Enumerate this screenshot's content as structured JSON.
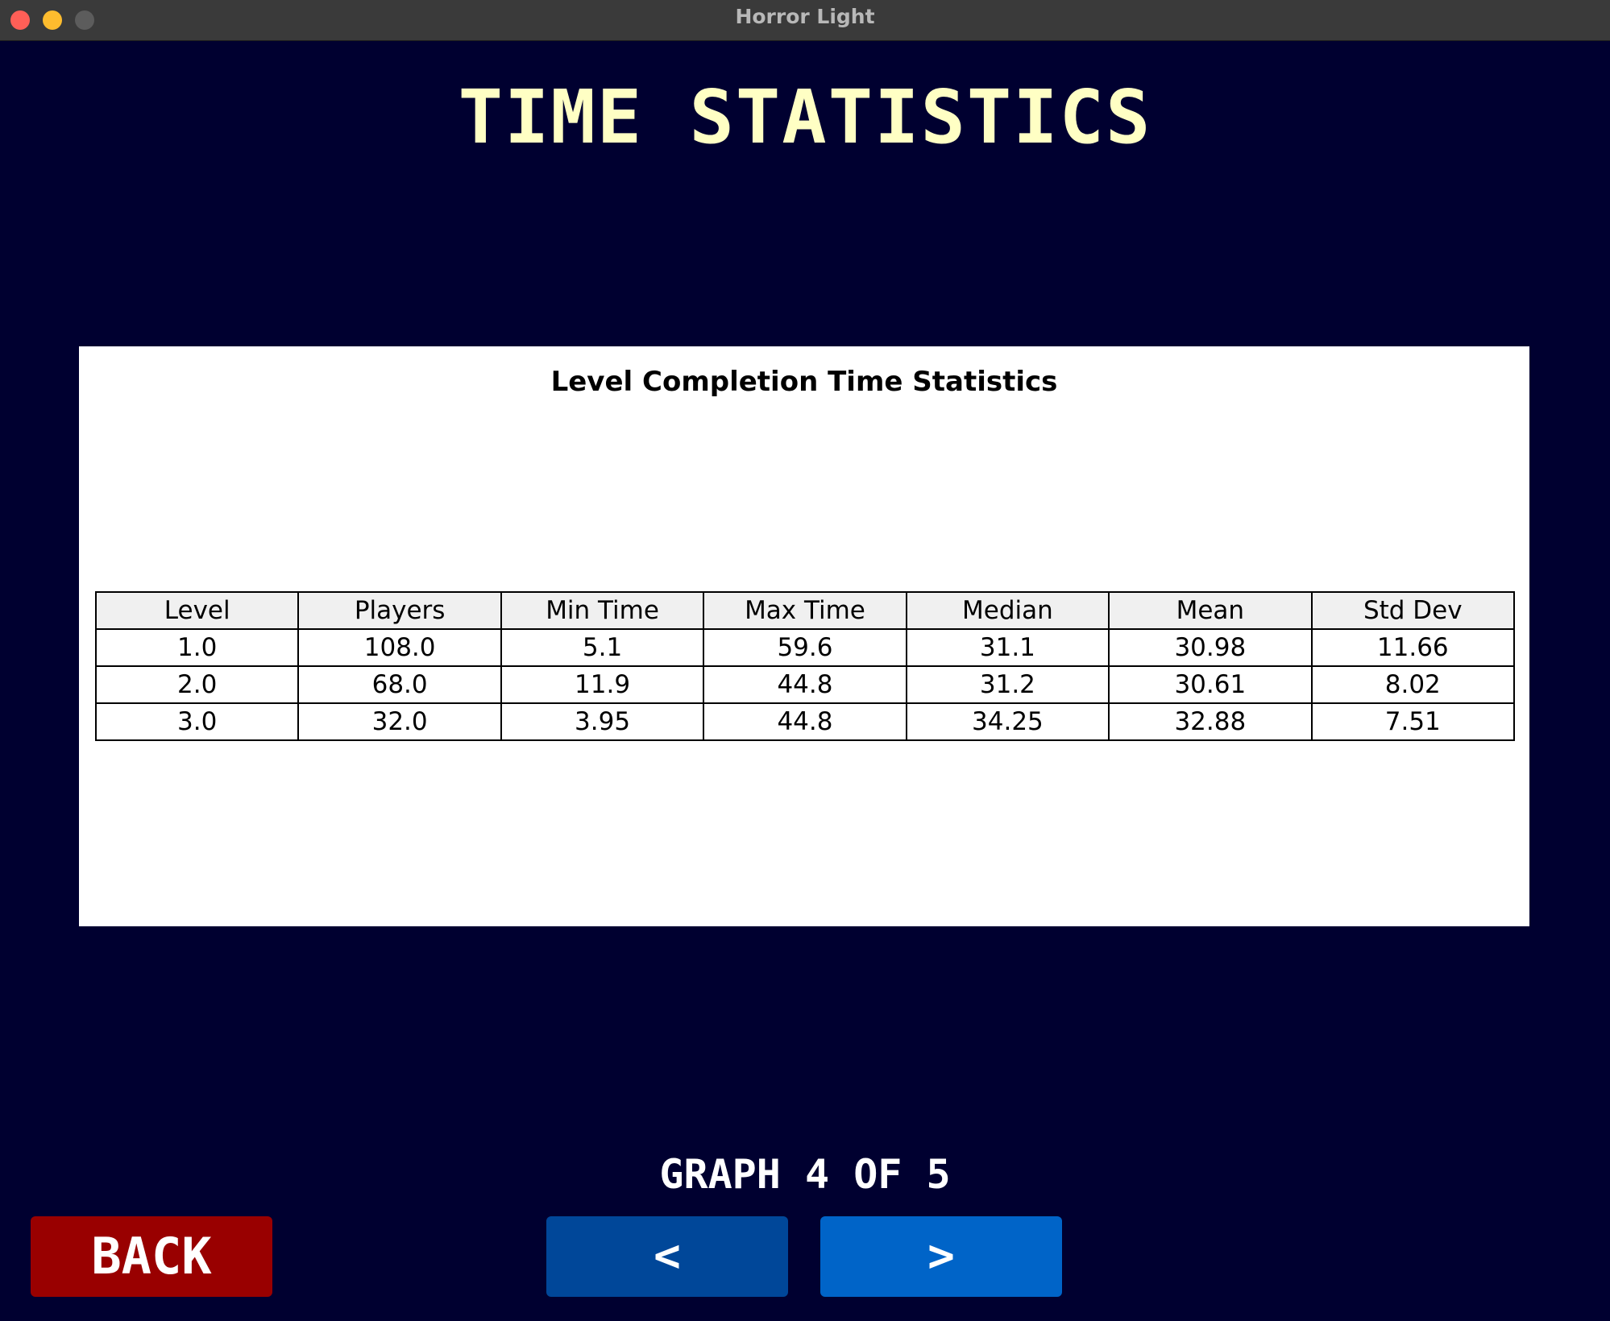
{
  "window": {
    "title": "Horror Light"
  },
  "page": {
    "title": "TIME STATISTICS"
  },
  "table": {
    "title": "Level Completion Time Statistics",
    "columns": [
      "Level",
      "Players",
      "Min Time",
      "Max Time",
      "Median",
      "Mean",
      "Std Dev"
    ],
    "rows": [
      [
        "1.0",
        "108.0",
        "5.1",
        "59.6",
        "31.1",
        "30.98",
        "11.66"
      ],
      [
        "2.0",
        "68.0",
        "11.9",
        "44.8",
        "31.2",
        "30.61",
        "8.02"
      ],
      [
        "3.0",
        "32.0",
        "3.95",
        "44.8",
        "34.25",
        "32.88",
        "7.51"
      ]
    ]
  },
  "pager": {
    "label": "GRAPH 4 OF 5"
  },
  "buttons": {
    "back": "BACK",
    "prev": "<",
    "next": ">"
  },
  "colors": {
    "background": "#000030",
    "title": "#ffffc4",
    "back_button": "#990000",
    "prev_button": "#004799",
    "next_button": "#0064c8"
  }
}
